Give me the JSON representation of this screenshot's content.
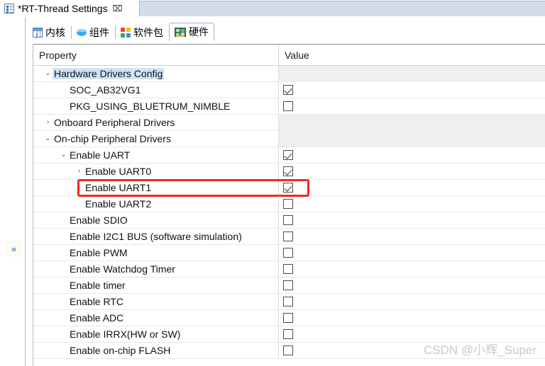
{
  "editor": {
    "tab_title": "*RT-Thread Settings",
    "tab_icon": "settings-doc-icon",
    "close_label": "⌧"
  },
  "inner_tabs": [
    {
      "label": "内核",
      "icon": "kernel-grid-icon",
      "selected": false
    },
    {
      "label": "组件",
      "icon": "components-cube-icon",
      "selected": false
    },
    {
      "label": "软件包",
      "icon": "packages-blocks-icon",
      "selected": false
    },
    {
      "label": "硬件",
      "icon": "hardware-board-icon",
      "selected": true
    }
  ],
  "left_rail": {
    "restore_label": "»",
    "restore_name": "restore-view-button"
  },
  "table": {
    "columns": [
      "Property",
      "Value"
    ],
    "rows": [
      {
        "label": "Hardware Drivers Config",
        "indent": 0,
        "twisty": "⌄",
        "value": "none",
        "selected": true,
        "highlight": false
      },
      {
        "label": "SOC_AB32VG1",
        "indent": 1,
        "twisty": "",
        "value": "checked",
        "selected": false,
        "highlight": false
      },
      {
        "label": "PKG_USING_BLUETRUM_NIMBLE",
        "indent": 1,
        "twisty": "",
        "value": "unchecked",
        "selected": false,
        "highlight": false
      },
      {
        "label": "Onboard Peripheral Drivers",
        "indent": 0,
        "twisty": "›",
        "value": "none",
        "selected": false,
        "highlight": false
      },
      {
        "label": "On-chip Peripheral Drivers",
        "indent": 0,
        "twisty": "⌄",
        "value": "none",
        "selected": false,
        "highlight": false
      },
      {
        "label": "Enable UART",
        "indent": 1,
        "twisty": "⌄",
        "value": "checked",
        "selected": false,
        "highlight": false
      },
      {
        "label": "Enable UART0",
        "indent": 2,
        "twisty": "›",
        "value": "checked",
        "selected": false,
        "highlight": false
      },
      {
        "label": "Enable UART1",
        "indent": 2,
        "twisty": "›",
        "value": "checked",
        "selected": false,
        "highlight": true
      },
      {
        "label": "Enable UART2",
        "indent": 2,
        "twisty": "",
        "value": "unchecked",
        "selected": false,
        "highlight": false
      },
      {
        "label": "Enable SDIO",
        "indent": 1,
        "twisty": "",
        "value": "unchecked",
        "selected": false,
        "highlight": false
      },
      {
        "label": "Enable I2C1 BUS (software simulation)",
        "indent": 1,
        "twisty": "",
        "value": "unchecked",
        "selected": false,
        "highlight": false
      },
      {
        "label": "Enable PWM",
        "indent": 1,
        "twisty": "",
        "value": "unchecked",
        "selected": false,
        "highlight": false
      },
      {
        "label": "Enable Watchdog Timer",
        "indent": 1,
        "twisty": "",
        "value": "unchecked",
        "selected": false,
        "highlight": false
      },
      {
        "label": "Enable timer",
        "indent": 1,
        "twisty": "",
        "value": "unchecked",
        "selected": false,
        "highlight": false
      },
      {
        "label": "Enable RTC",
        "indent": 1,
        "twisty": "",
        "value": "unchecked",
        "selected": false,
        "highlight": false
      },
      {
        "label": "Enable ADC",
        "indent": 1,
        "twisty": "",
        "value": "unchecked",
        "selected": false,
        "highlight": false
      },
      {
        "label": "Enable IRRX(HW or SW)",
        "indent": 1,
        "twisty": "",
        "value": "unchecked",
        "selected": false,
        "highlight": false
      },
      {
        "label": "Enable on-chip FLASH",
        "indent": 1,
        "twisty": "",
        "value": "unchecked",
        "selected": false,
        "highlight": false
      }
    ]
  },
  "annotation": {
    "highlight_color": "#ee2a24"
  },
  "watermark": {
    "text": "CSDN @小辉_Super"
  }
}
